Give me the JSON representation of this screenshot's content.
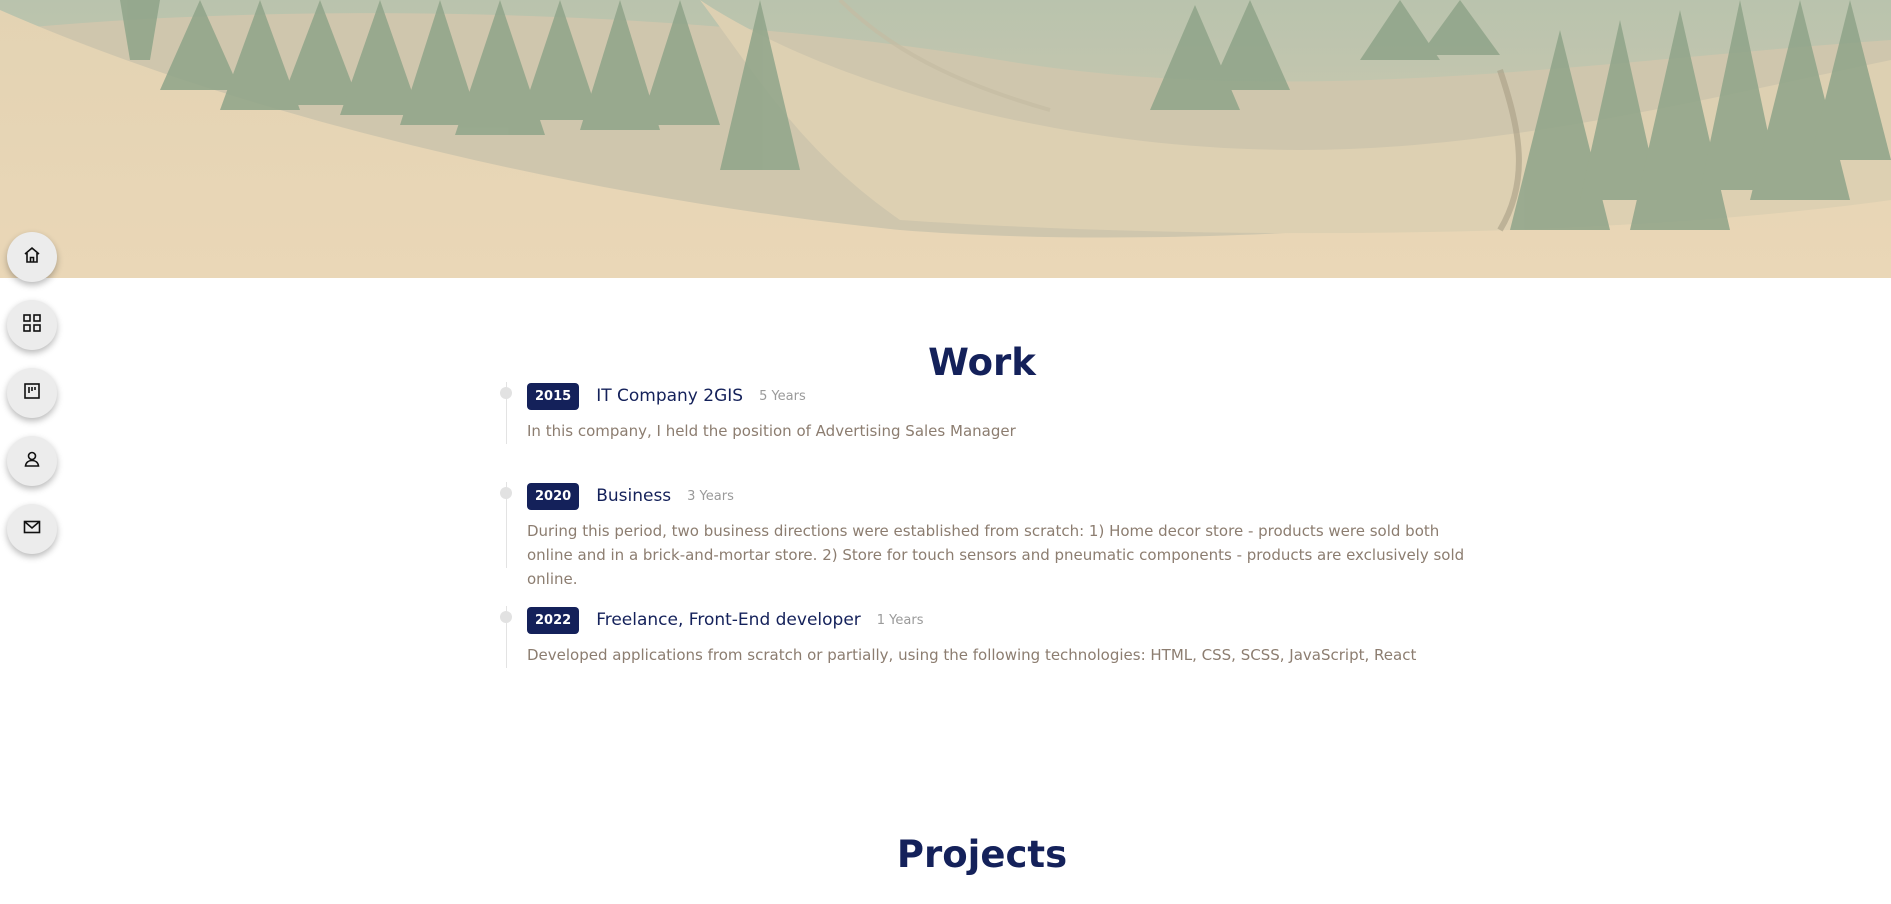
{
  "nav": {
    "items": [
      {
        "icon": "home-icon"
      },
      {
        "icon": "grid-icon"
      },
      {
        "icon": "kanban-icon"
      },
      {
        "icon": "user-icon"
      },
      {
        "icon": "mail-icon"
      }
    ]
  },
  "work": {
    "title": "Work",
    "items": [
      {
        "year": "2015",
        "company": "IT Company 2GIS",
        "duration": "5 Years",
        "description": "In this company, I held the position of Advertising Sales Manager"
      },
      {
        "year": "2020",
        "company": "Business",
        "duration": "3 Years",
        "description": "During this period, two business directions were established from scratch: 1) Home decor store - products were sold both online and in a brick-and-mortar store. 2) Store for touch sensors and pneumatic components - products are exclusively sold online."
      },
      {
        "year": "2022",
        "company": "Freelance, Front-End developer",
        "duration": "1 Years",
        "description": "Developed applications from scratch or partially, using the following technologies: HTML, CSS, SCSS, JavaScript, React"
      }
    ]
  },
  "projects": {
    "title": "Projects"
  },
  "colors": {
    "accent": "#14215a",
    "description_text": "#8c7d70",
    "duration_text": "#9a9a9a",
    "nav_button": "#ececec"
  }
}
